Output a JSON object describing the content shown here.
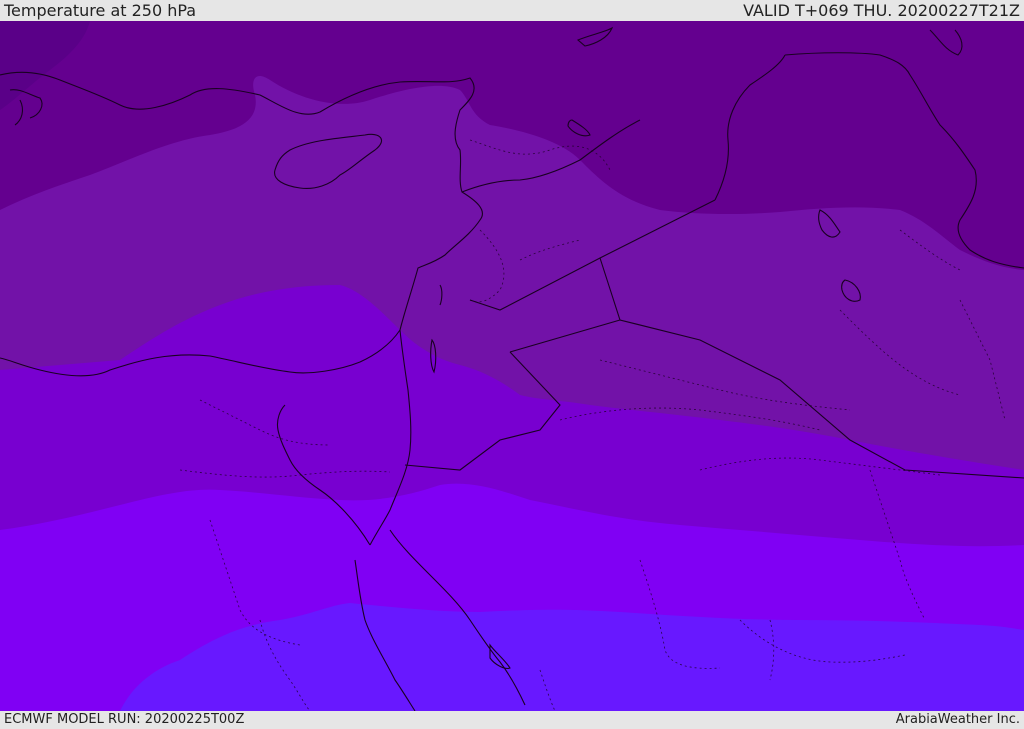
{
  "header": {
    "title": "Temperature at 250 hPa",
    "valid": "VALID T+069 THU. 20200227T21Z"
  },
  "footer": {
    "model_run": "ECMWF MODEL RUN: 20200225T00Z",
    "credit": "ArabiaWeather Inc."
  },
  "palette": {
    "band_darkest": "#5a0088",
    "band_dark": "#64008f",
    "band_mid": "#7212a8",
    "band_violet": "#7800d0",
    "band_bright": "#8000f4",
    "band_blue": "#6818ff",
    "coastline": "#1a0022"
  }
}
